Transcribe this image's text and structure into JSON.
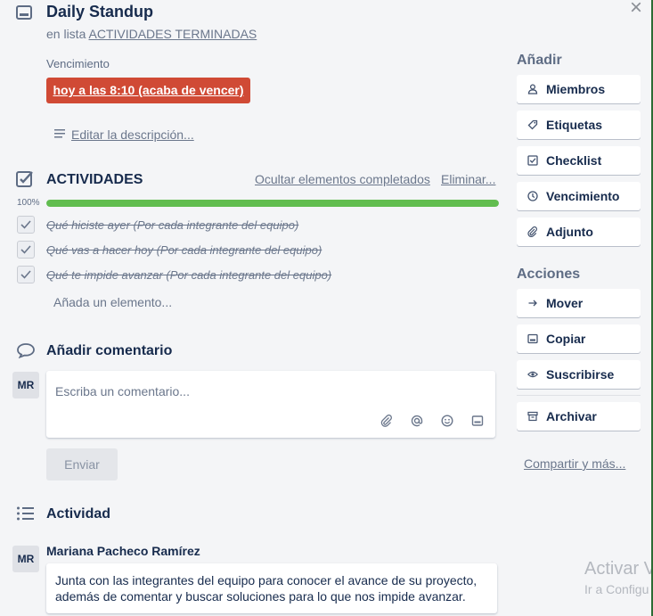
{
  "header": {
    "title": "Daily Standup",
    "list_prefix": "en lista",
    "list_name": "ACTIVIDADES TERMINADAS",
    "close_symbol": "×"
  },
  "due": {
    "label": "Vencimiento",
    "badge": "hoy a las 8:10 (acaba de vencer)",
    "color": "#d04a35"
  },
  "description": {
    "edit_label": "Editar la descripción..."
  },
  "checklist": {
    "title": "ACTIVIDADES",
    "hide_completed": "Ocultar elementos completados",
    "delete": "Eliminar...",
    "progress_label": "100%",
    "progress_value": 100,
    "progress_color": "#61bd4f",
    "items": [
      {
        "text": "Qué hiciste ayer (Por cada integrante del equipo)",
        "checked": true
      },
      {
        "text": "Qué vas a hacer hoy (Por cada integrante del equipo)",
        "checked": true
      },
      {
        "text": "Qué te impide avanzar (Por cada integrante del equipo)",
        "checked": true
      }
    ],
    "add_item": "Añada un elemento..."
  },
  "comment": {
    "title": "Añadir comentario",
    "avatar": "MR",
    "placeholder": "Escriba un comentario...",
    "tools": [
      "attachment-icon",
      "mention-icon",
      "emoji-icon",
      "card-icon"
    ],
    "send": "Enviar"
  },
  "activity": {
    "title": "Actividad",
    "avatar": "MR",
    "user": "Mariana Pacheco Ramírez",
    "message": "Junta con las integrantes del equipo para conocer el avance de su proyecto, además de comentar y buscar soluciones para lo que nos impide avanzar."
  },
  "sidebar": {
    "add_title": "Añadir",
    "add_buttons": [
      {
        "label": "Miembros",
        "icon": "person-icon"
      },
      {
        "label": "Etiquetas",
        "icon": "tag-icon"
      },
      {
        "label": "Checklist",
        "icon": "checkbox-icon"
      },
      {
        "label": "Vencimiento",
        "icon": "clock-icon"
      },
      {
        "label": "Adjunto",
        "icon": "paperclip-icon"
      }
    ],
    "actions_title": "Acciones",
    "action_buttons": [
      {
        "label": "Mover",
        "icon": "arrow-right-icon"
      },
      {
        "label": "Copiar",
        "icon": "card-icon"
      },
      {
        "label": "Suscribirse",
        "icon": "eye-icon"
      },
      {
        "label": "Archivar",
        "icon": "archive-icon"
      }
    ],
    "share": "Compartir y más..."
  },
  "watermark": {
    "line1": "Activar V",
    "line2": "Ir a Configu"
  }
}
